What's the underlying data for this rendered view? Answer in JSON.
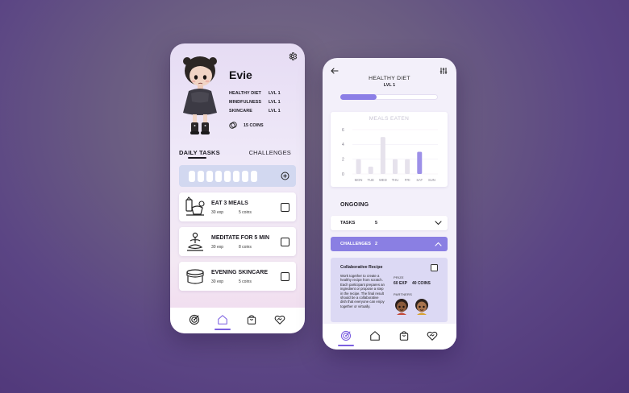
{
  "profile_screen": {
    "name": "Evie",
    "skills": [
      {
        "name": "HEALTHY DIET",
        "level": "LVL 1"
      },
      {
        "name": "MINDFULNESS",
        "level": "LVL 1"
      },
      {
        "name": "SKINCARE",
        "level": "LVL 1"
      }
    ],
    "coins": "15 COINS",
    "tabs": {
      "daily": "DAILY TASKS",
      "challenges": "CHALLENGES"
    },
    "daily_progress": {
      "total_slots": 8,
      "filled": 0
    },
    "tasks": [
      {
        "title": "EAT 3 MEALS",
        "exp": "30 exp",
        "coins": "5 coins",
        "icon": "meal-icon"
      },
      {
        "title": "MEDITATE FOR 5 MIN",
        "exp": "30 exp",
        "coins": "8 coins",
        "icon": "meditation-icon"
      },
      {
        "title": "EVENING SKINCARE",
        "exp": "30 exp",
        "coins": "5 coins",
        "icon": "skincare-jar-icon"
      }
    ],
    "nav": [
      "target-icon",
      "home-icon",
      "shopping-bag-icon",
      "heart-handshake-icon"
    ],
    "nav_active": "home-icon"
  },
  "detail_screen": {
    "title": "HEALTHY DIET",
    "subtitle": "LVL 1",
    "level_progress": 0.37,
    "ongoing_label": "ONGOING",
    "tasks_row": {
      "label": "TASKS",
      "count": "5"
    },
    "challenges_row": {
      "label": "CHALLENGES",
      "count": "2"
    },
    "challenge": {
      "title": "Collaborative Recipe",
      "description": "Work together to create a healthy recipe from scratch. Each participant prepares an ingredient or propose a step in the recipe. The final result should be a collaborative dish that everyone can enjoy together or virtually.",
      "prize_label": "PRIZE",
      "prize_exp": "60 EXP",
      "prize_coins": "40 COINS",
      "partners_label": "PARTNERS"
    },
    "nav": [
      "target-icon",
      "home-icon",
      "shopping-bag-icon",
      "heart-handshake-icon"
    ],
    "nav_active": "target-icon"
  },
  "chart_data": {
    "type": "bar",
    "title": "MEALS EATEN",
    "categories": [
      "MON",
      "TUE",
      "WED",
      "THU",
      "FRI",
      "SAT",
      "SUN"
    ],
    "values": [
      2,
      1,
      5,
      2,
      2,
      3,
      0
    ],
    "highlight_index": 5,
    "yticks": [
      0,
      2,
      4,
      6
    ],
    "ylim": [
      0,
      6
    ],
    "colors": {
      "bar": "#e6e2ec",
      "highlight": "#9d90e8"
    },
    "grid": true
  },
  "colors": {
    "accent": "#8a7fe3",
    "nav_active": "#7b5fe0"
  }
}
